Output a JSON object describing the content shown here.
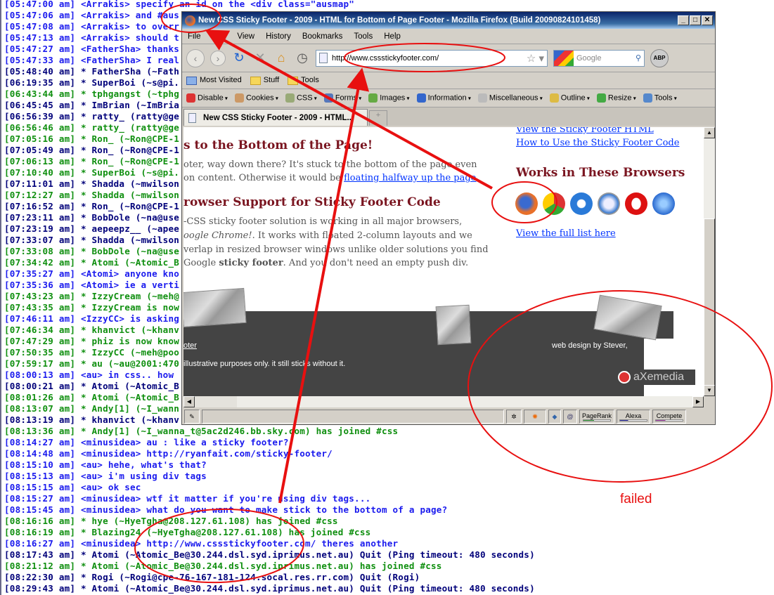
{
  "chat": {
    "lines": [
      {
        "t": "[05:47:00 am] <Arrakis> specify an id on the <div class=\"ausmap\"",
        "c": "blue"
      },
      {
        "t": "[05:47:06 am] <Arrakis> and #aus",
        "c": "blue"
      },
      {
        "t": "[05:47:08 am] <Arrakis> to overr",
        "c": "blue"
      },
      {
        "t": "[05:47:13 am] <Arrakis> should t",
        "c": "blue"
      },
      {
        "t": "[05:47:27 am] <FatherSha> thanks",
        "c": "blue"
      },
      {
        "t": "[05:47:33 am] <FatherSha> I real",
        "c": "blue"
      },
      {
        "t": "[05:48:40 am] * FatherSha (~Fath",
        "c": "navy"
      },
      {
        "t": "[06:19:35 am] * SuperBoi (~s@pi.",
        "c": "navy"
      },
      {
        "t": "[06:43:44 am] * tphgangst (~tphg",
        "c": "green"
      },
      {
        "t": "[06:45:45 am] * ImBrian (~ImBria",
        "c": "navy"
      },
      {
        "t": "[06:56:39 am] * ratty_ (ratty@ge",
        "c": "navy"
      },
      {
        "t": "[06:56:46 am] * ratty_ (ratty@ge",
        "c": "green"
      },
      {
        "t": "[07:05:16 am] * Ron_ (~Ron@CPE-1",
        "c": "green"
      },
      {
        "t": "[07:05:49 am] * Ron_ (~Ron@CPE-1",
        "c": "navy"
      },
      {
        "t": "[07:06:13 am] * Ron_ (~Ron@CPE-1",
        "c": "green"
      },
      {
        "t": "[07:10:40 am] * SuperBoi (~s@pi.",
        "c": "green"
      },
      {
        "t": "[07:11:01 am] * Shadda (~mwilson",
        "c": "navy"
      },
      {
        "t": "[07:12:27 am] * Shadda (~mwilson",
        "c": "green"
      },
      {
        "t": "[07:16:52 am] * Ron_ (~Ron@CPE-1",
        "c": "navy"
      },
      {
        "t": "[07:23:11 am] * BobDole (~na@use",
        "c": "navy"
      },
      {
        "t": "[07:23:19 am] * aepeepz__ (~apee",
        "c": "navy"
      },
      {
        "t": "[07:33:07 am] * Shadda (~mwilson",
        "c": "navy"
      },
      {
        "t": "[07:33:08 am] * BobDole (~na@use",
        "c": "green"
      },
      {
        "t": "[07:34:42 am] * Atomi (~Atomic_B",
        "c": "green"
      },
      {
        "t": "[07:35:27 am] <Atomi> anyone kno",
        "c": "blue"
      },
      {
        "t": "[07:35:36 am] <Atomi> ie a verti",
        "c": "blue"
      },
      {
        "t": "[07:43:23 am] * IzzyCream (~meh@",
        "c": "green"
      },
      {
        "t": "[07:43:35 am] * IzzyCream is now",
        "c": "green"
      },
      {
        "t": "[07:46:11 am] <IzzyCC> is asking",
        "c": "blue"
      },
      {
        "t": "[07:46:34 am] * khanvict (~khanv",
        "c": "green"
      },
      {
        "t": "[07:47:29 am] * phiz is now know",
        "c": "green"
      },
      {
        "t": "[07:50:35 am] * IzzyCC (~meh@poo",
        "c": "green"
      },
      {
        "t": "[07:59:17 am] * au (~au@2001:470",
        "c": "green"
      },
      {
        "t": "[08:00:13 am] <au> in css.. how",
        "c": "blue"
      },
      {
        "t": "[08:00:21 am] * Atomi (~Atomic_B",
        "c": "navy"
      },
      {
        "t": "[08:01:26 am] * Atomi (~Atomic_B",
        "c": "green"
      },
      {
        "t": "[08:13:07 am] * Andy[1] (~I_wann",
        "c": "green"
      },
      {
        "t": "[08:13:19 am] * khanvict (~khanv",
        "c": "navy"
      },
      {
        "t": "[08:13:36 am] * Andy[1] (~I_wanna_t@5ac2d246.bb.sky.com) has joined #css",
        "c": "green"
      },
      {
        "t": "[08:14:27 am] <minusidea> au : like a sticky footer?",
        "c": "blue"
      },
      {
        "t": "[08:14:48 am] <minusidea> http://ryanfait.com/sticky-footer/",
        "c": "blue"
      },
      {
        "t": "[08:15:10 am] <au> hehe, what's that?",
        "c": "blue"
      },
      {
        "t": "[08:15:13 am] <au> i'm using div tags",
        "c": "blue"
      },
      {
        "t": "[08:15:15 am] <au> ok sec",
        "c": "blue"
      },
      {
        "t": "[08:15:27 am] <minusidea> wtf it matter if you're using div tags...",
        "c": "blue"
      },
      {
        "t": "[08:15:45 am] <minusidea> what do you want to make stick to the bottom of a page?",
        "c": "blue"
      },
      {
        "t": "[08:16:16 am] * hye (~HyeTgha@208.127.61.108) has joined #css",
        "c": "green"
      },
      {
        "t": "[08:16:19 am] * Blazing24 (~HyeTgha@208.127.61.108) has joined #css",
        "c": "green"
      },
      {
        "t": "[08:16:27 am] <minusidea> http://www.cssstickyfooter.com/ theres another",
        "c": "blue"
      },
      {
        "t": "[08:17:43 am] * Atomi (~Atomic_Be@30.244.dsl.syd.iprimus.net.au) Quit (Ping timeout: 480 seconds)",
        "c": "navy"
      },
      {
        "t": "[08:21:12 am] * Atomi (~Atomic_Be@30.244.dsl.syd.iprimus.net.au) has joined #css",
        "c": "green"
      },
      {
        "t": "[08:22:30 am] * Rogi (~Rogi@cpe-76-167-181-124.socal.res.rr.com) Quit (Rogi)",
        "c": "navy"
      },
      {
        "t": "[08:29:43 am] * Atomi (~Atomic_Be@30.244.dsl.syd.iprimus.net.au) Quit (Ping timeout: 480 seconds)",
        "c": "navy"
      }
    ]
  },
  "colors": {
    "blue": "#1a1aee",
    "navy": "#00007a",
    "green": "#0f8f0f",
    "annotation": "#e81010"
  },
  "browser": {
    "title": "New CSS Sticky Footer - 2009 - HTML for Bottom of Page Footer - Mozilla Firefox (Build 20090824101458)",
    "menu": [
      "File",
      "Edit",
      "View",
      "History",
      "Bookmarks",
      "Tools",
      "Help"
    ],
    "url": "http://www.cssstickyfooter.com/",
    "search_placeholder": "Google",
    "abp": "ABP",
    "bookmarks": [
      "Most Visited",
      "Stuff",
      "Tools"
    ],
    "webdev": [
      "Disable",
      "Cookies",
      "CSS",
      "Forms",
      "Images",
      "Information",
      "Miscellaneous",
      "Outline",
      "Resize",
      "Tools"
    ],
    "tab": "New CSS Sticky Footer - 2009 - HTML...",
    "status": [
      "PageRank",
      "Alexa",
      "Compete"
    ]
  },
  "page": {
    "h_bottom": "s to the Bottom of the Page!",
    "p1a": "oter, way down there? It's stuck to the bottom of the page even",
    "p1b": "on content. Otherwise it would be ",
    "p1link": "floating halfway up the page",
    "h_support": "rowser Support for Sticky Footer Code",
    "p2a": "-CSS sticky footer solution is working in all major browsers,",
    "p2b_i": "oogle Chrome!",
    "p2b": ". It works with floated 2-column layouts and we",
    "p2c": "verlap in resized browser windows unlike older solutions you find",
    "p2d": "Google ",
    "p2d_b": "sticky footer",
    "p2e": ". And you don't need an empty push div.",
    "side_links": [
      "View the Sticky Footer HTML",
      "How to Use the Sticky Footer Code"
    ],
    "works_heading": "Works in These Browsers",
    "browsers": [
      "firefox-icon",
      "chrome-icon",
      "ie-icon",
      "safari-icon",
      "opera-icon",
      "konqueror-icon"
    ],
    "full_list": "View the full list here",
    "footer_link": "oter",
    "footer_note": "illustrative purposes only. it still sticks without it.",
    "footer_credit": "web design by Stever,",
    "logo": "aXemedia"
  },
  "annotation": {
    "failed": "failed"
  }
}
